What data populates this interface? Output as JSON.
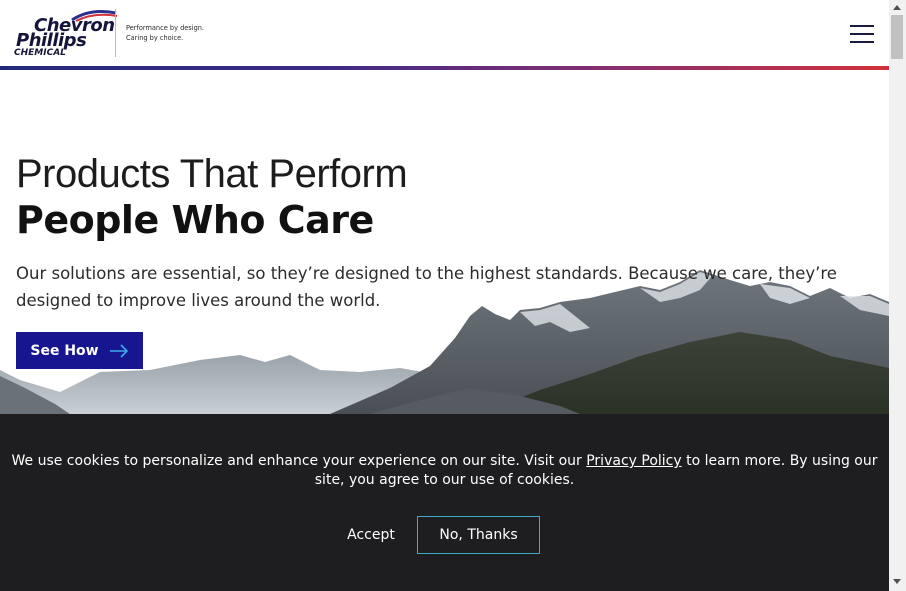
{
  "header": {
    "logo": {
      "line1": "Chevron",
      "line2": "Phillips",
      "line3": "CHEMICAL"
    },
    "tagline": {
      "line1": "Performance by design.",
      "line2": "Caring by choice."
    },
    "menu_icon": "hamburger-menu-icon",
    "rule_colors": [
      "#242a7a",
      "#d2303a"
    ]
  },
  "hero": {
    "title_light": "Products That Perform",
    "title_bold": "People Who Care",
    "paragraph": "Our solutions are essential, so they’re designed to the highest standards. Because we care, they’re designed to improve lives around the world.",
    "cta_label": "See How",
    "cta_icon": "arrow-right-icon",
    "cta_color": "#171690"
  },
  "cookie_banner": {
    "text_before_link": "We use cookies to personalize and enhance your experience on our site. Visit our ",
    "link_text": "Privacy Policy",
    "text_after_link": " to learn more. By using our site, you agree to our use of cookies.",
    "accept_label": "Accept",
    "decline_label": "No, Thanks",
    "background": "#1e1e21",
    "accent": "#3fa9c9"
  }
}
